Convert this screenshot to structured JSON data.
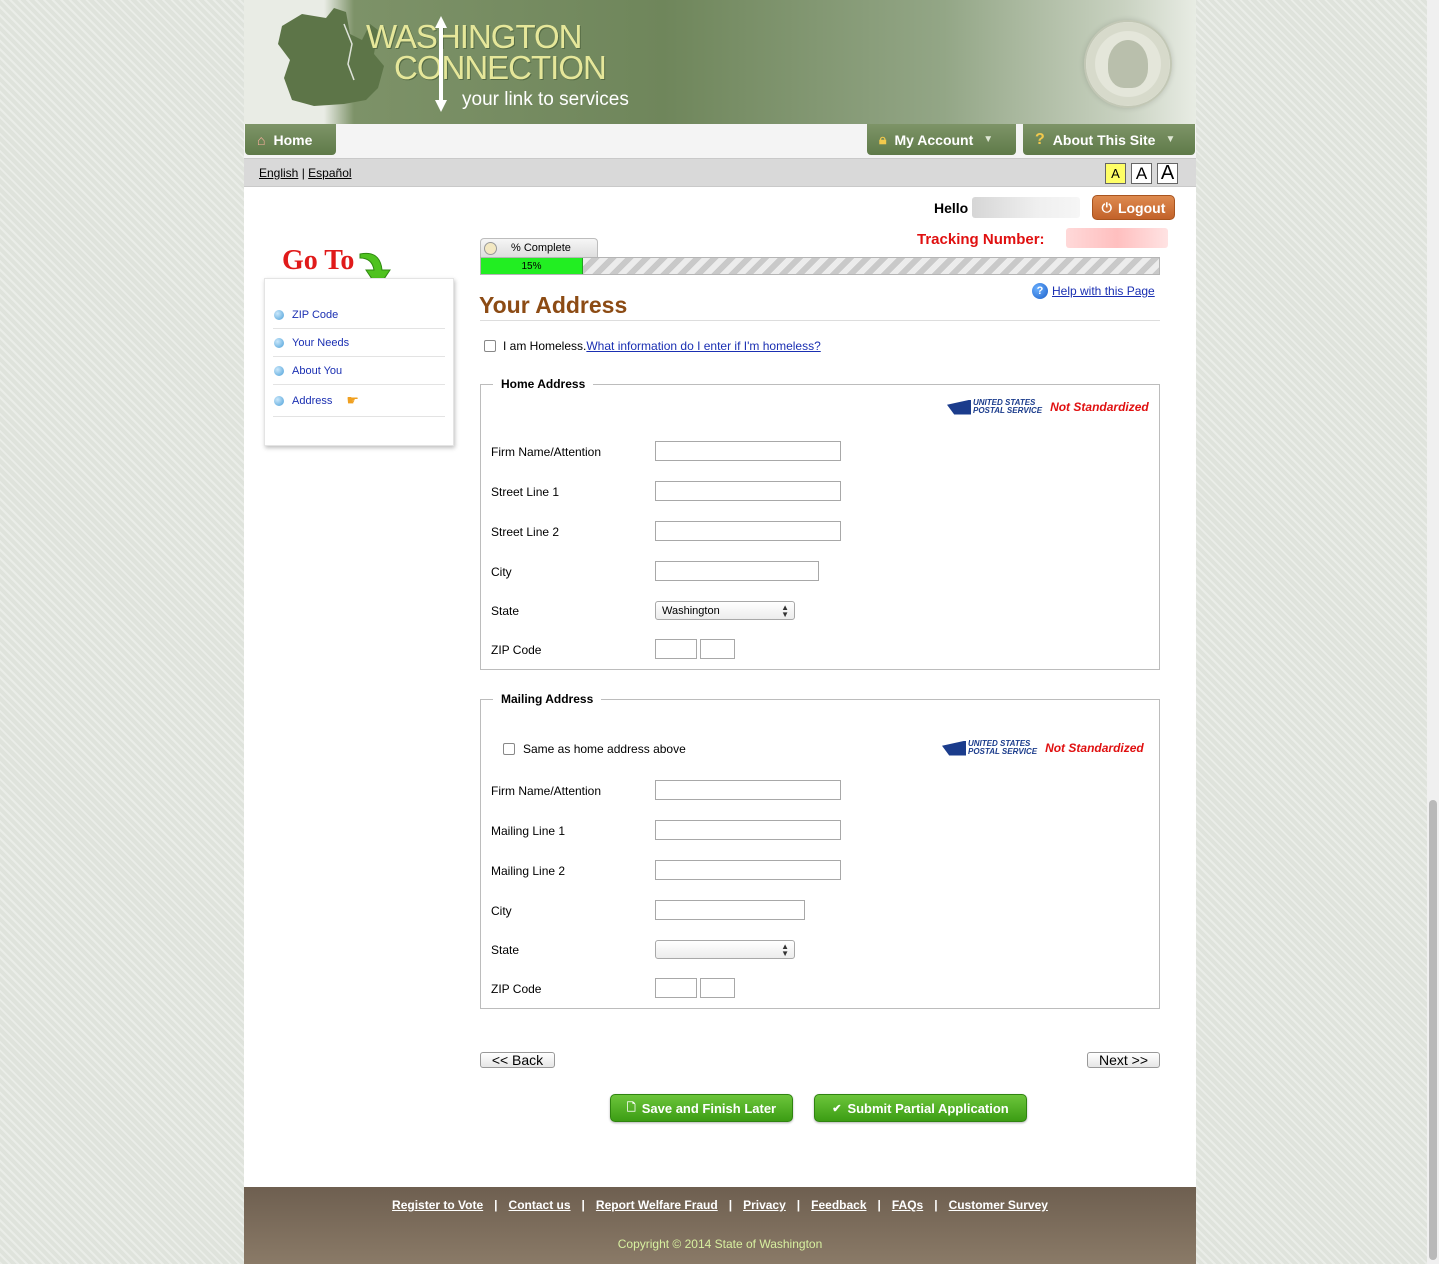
{
  "header": {
    "logo_line1": "WASHINGTON",
    "logo_line2": "CONNECTION",
    "logo_tagline": "your link to services",
    "seal_name": "state-seal"
  },
  "nav": {
    "home": "Home",
    "my_account": "My Account",
    "about": "About This Site"
  },
  "lang": {
    "english": "English",
    "separator": "|",
    "spanish": "Español"
  },
  "font_sizes": [
    "A",
    "A",
    "A"
  ],
  "user": {
    "hello": "Hello",
    "logout": "Logout",
    "tracking_label": "Tracking Number:"
  },
  "sidebar": {
    "title": "Go To",
    "items": [
      {
        "label": "ZIP Code"
      },
      {
        "label": "Your Needs"
      },
      {
        "label": "About You"
      },
      {
        "label": "Address"
      }
    ]
  },
  "progress": {
    "label": "% Complete",
    "percent_text": "15%",
    "value": 0.15
  },
  "page": {
    "title": "Your Address",
    "help": "Help with this Page",
    "homeless_label": "I am Homeless.",
    "homeless_link": "What information do I enter if I'm homeless?"
  },
  "usps": {
    "line1": "UNITED STATES",
    "line2": "POSTAL SERVICE",
    "status": "Not Standardized"
  },
  "home_address": {
    "legend": "Home Address",
    "firm": "Firm Name/Attention",
    "street1": "Street Line 1",
    "street2": "Street Line 2",
    "city": "City",
    "state": "State",
    "state_value": "Washington",
    "zip": "ZIP Code"
  },
  "mailing_address": {
    "legend": "Mailing Address",
    "same_as": "Same as home address above",
    "firm": "Firm Name/Attention",
    "line1": "Mailing Line 1",
    "line2": "Mailing Line 2",
    "city": "City",
    "state": "State",
    "state_value": "",
    "zip": "ZIP Code"
  },
  "buttons": {
    "back": "<< Back",
    "next": "Next >>",
    "save": "Save and Finish Later",
    "submit": "Submit Partial Application"
  },
  "footer": {
    "links": [
      "Register to Vote",
      "Contact us",
      "Report Welfare Fraud",
      "Privacy",
      "Feedback",
      "FAQs",
      "Customer Survey"
    ],
    "separator": "|",
    "copyright": "Copyright © 2014 State of Washington"
  }
}
